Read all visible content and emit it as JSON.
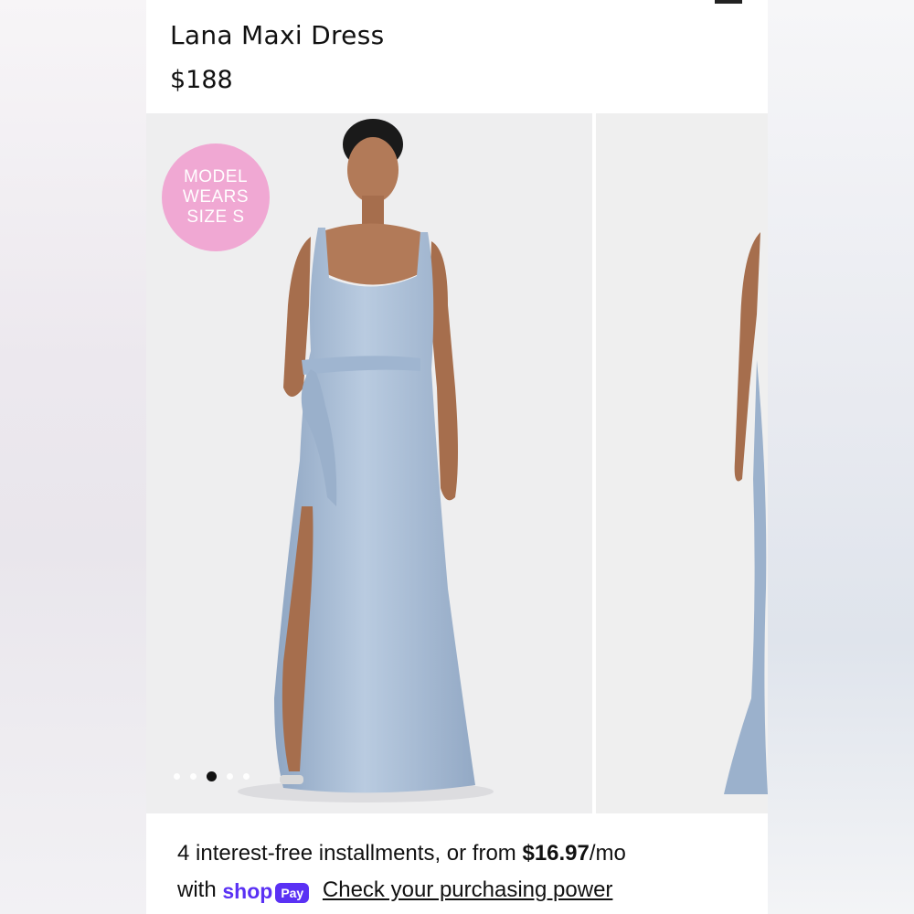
{
  "product": {
    "title": "Lana Maxi Dress",
    "price": "$188"
  },
  "gallery": {
    "badge_lines": [
      "MODEL",
      "WEARS",
      "SIZE S"
    ],
    "dots_count": 5,
    "active_dot_index": 2
  },
  "installments": {
    "prefix": "4 interest-free installments, or from ",
    "amount": "$16.97",
    "suffix": "/mo",
    "with_label": "with",
    "shop_label": "shop",
    "pay_label": "Pay",
    "link_label": "Check your purchasing power"
  },
  "colors": {
    "badge": "#f0a8d3",
    "dress": "#a8bdd6",
    "shop_purple": "#5a31f4"
  }
}
